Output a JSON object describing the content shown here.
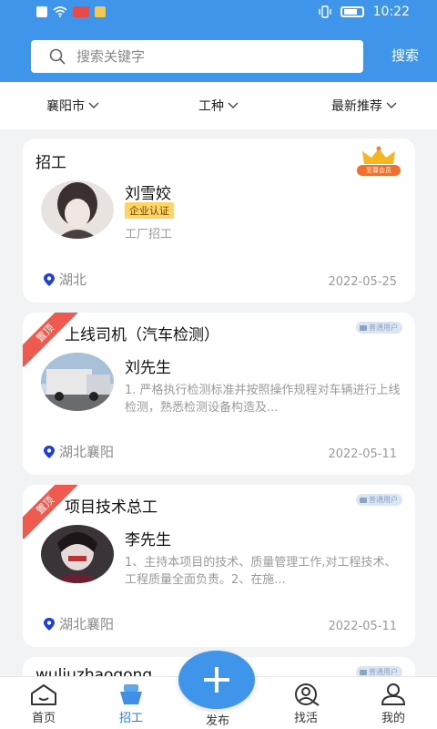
{
  "status": {
    "time": "10:22"
  },
  "search": {
    "placeholder": "搜索关键字",
    "button": "搜索"
  },
  "filters": [
    "襄阳市",
    "工种",
    "最新推荐"
  ],
  "cards": [
    {
      "title": "招工",
      "name": "刘雪姣",
      "cert": "企业认证",
      "desc": "工厂招工",
      "location": "湖北",
      "date": "2022-05-25",
      "tag": "至尊会员"
    },
    {
      "title": "上线司机（汽车检测）",
      "name": "刘先生",
      "desc": "1. 严格执行检测标准并按照操作规程对车辆进行上线检测，熟悉检测设备构造及...",
      "location": "湖北襄阳",
      "date": "2022-05-11",
      "ribbon": "置顶",
      "tag": "普通用户"
    },
    {
      "title": "项目技术总工",
      "name": "李先生",
      "desc": "1、主持本项目的技术、质量管理工作,对工程技术、工程质量全面负责。2、在施...",
      "location": "湖北襄阳",
      "date": "2022-05-11",
      "ribbon": "置顶",
      "tag": "普通用户"
    },
    {
      "title": "wuliuzhaogong",
      "tag": "普通用户"
    }
  ],
  "nav": {
    "home": "首页",
    "recruit": "招工",
    "publish": "发布",
    "findwork": "找活",
    "mine": "我的"
  }
}
